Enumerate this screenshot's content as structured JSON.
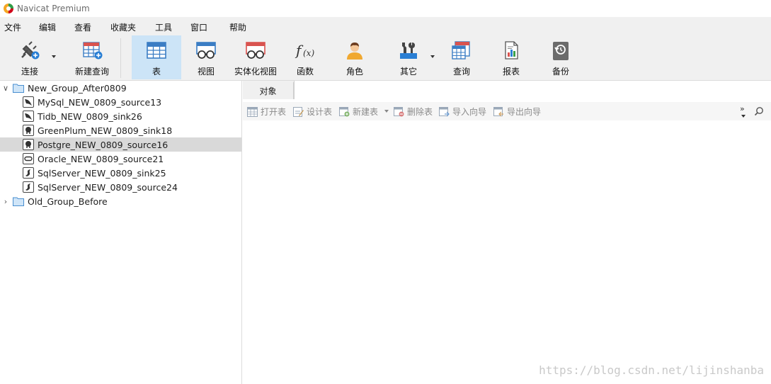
{
  "window": {
    "title": "Navicat Premium"
  },
  "menu": [
    "文件",
    "编辑",
    "查看",
    "收藏夹",
    "工具",
    "窗口",
    "帮助"
  ],
  "toolbar": {
    "connect": "连接",
    "new_query": "新建查询",
    "table": "表",
    "view": "视图",
    "materialized_view": "实体化视图",
    "function": "函数",
    "role": "角色",
    "other": "其它",
    "query": "查询",
    "report": "报表",
    "backup": "备份"
  },
  "tree": {
    "group1": "New_Group_After0809",
    "connections": [
      "MySql_NEW_0809_source13",
      "Tidb_NEW_0809_sink26",
      "GreenPlum_NEW_0809_sink18",
      "Postgre_NEW_0809_source16",
      "Oracle_NEW_0809_source21",
      "SqlServer_NEW_0809_sink25",
      "SqlServer_NEW_0809_source24"
    ],
    "group2": "Old_Group_Before"
  },
  "main": {
    "tab_label": "对象",
    "actions": {
      "open_table": "打开表",
      "design_table": "设计表",
      "new_table": "新建表",
      "delete_table": "删除表",
      "import_wizard": "导入向导",
      "export_wizard": "导出向导"
    }
  },
  "watermark": "https://blog.csdn.net/lijinshanba",
  "colors": {
    "active_tab": "#cce4f7",
    "selected_row": "#d9d9d9",
    "folder": "#5aa0d8"
  }
}
